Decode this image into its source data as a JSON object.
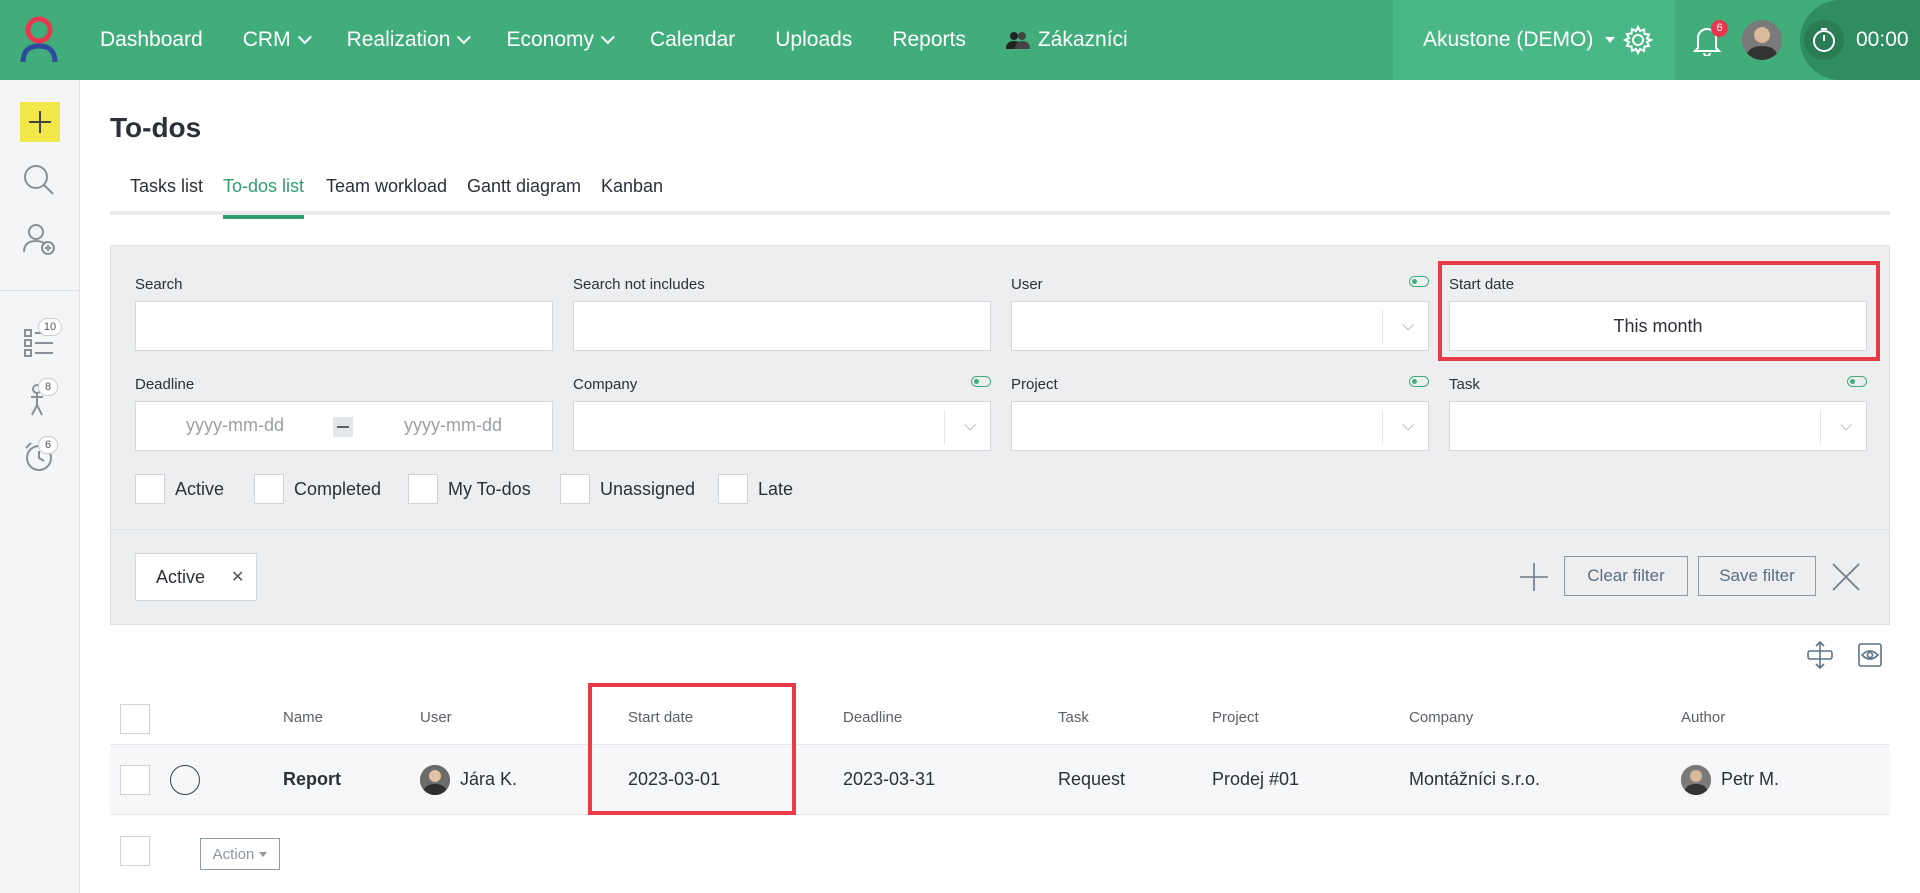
{
  "nav": {
    "items": [
      {
        "label": "Dashboard",
        "dropdown": false
      },
      {
        "label": "CRM",
        "dropdown": true
      },
      {
        "label": "Realization",
        "dropdown": true
      },
      {
        "label": "Economy",
        "dropdown": true
      },
      {
        "label": "Calendar",
        "dropdown": false
      },
      {
        "label": "Uploads",
        "dropdown": false
      },
      {
        "label": "Reports",
        "dropdown": false
      },
      {
        "label": "Zákazníci",
        "dropdown": false
      }
    ],
    "account": "Akustone (DEMO)",
    "notifications": "6",
    "timer": "00:00"
  },
  "sidebar": {
    "todos_badge": "10",
    "tasks_badge": "8",
    "reminders_badge": "6"
  },
  "page": {
    "title": "To-dos",
    "tabs": [
      "Tasks list",
      "To-dos list",
      "Team workload",
      "Gantt diagram",
      "Kanban"
    ],
    "active_tab": "To-dos list"
  },
  "filters": {
    "search_label": "Search",
    "search_value": "",
    "search_not_label": "Search not includes",
    "search_not_value": "",
    "user_label": "User",
    "start_date_label": "Start date",
    "start_date_value": "This month",
    "deadline_label": "Deadline",
    "date_placeholder": "yyyy-mm-dd",
    "company_label": "Company",
    "project_label": "Project",
    "task_label": "Task",
    "checkboxes": [
      "Active",
      "Completed",
      "My To-dos",
      "Unassigned",
      "Late"
    ],
    "chip": "Active",
    "clear_label": "Clear filter",
    "save_label": "Save filter"
  },
  "table": {
    "columns": [
      "Name",
      "User",
      "Start date",
      "Deadline",
      "Task",
      "Project",
      "Company",
      "Author"
    ],
    "rows": [
      {
        "name": "Report",
        "user": "Jára K.",
        "start_date": "2023-03-01",
        "deadline": "2023-03-31",
        "task": "Request",
        "project": "Prodej #01",
        "company": "Montážníci s.r.o.",
        "author": "Petr M."
      }
    ],
    "action_label": "Action"
  },
  "colors": {
    "brand_green": "#41ad7b",
    "accent_yellow": "#f2e84a",
    "highlight_red": "#ea3c46"
  }
}
